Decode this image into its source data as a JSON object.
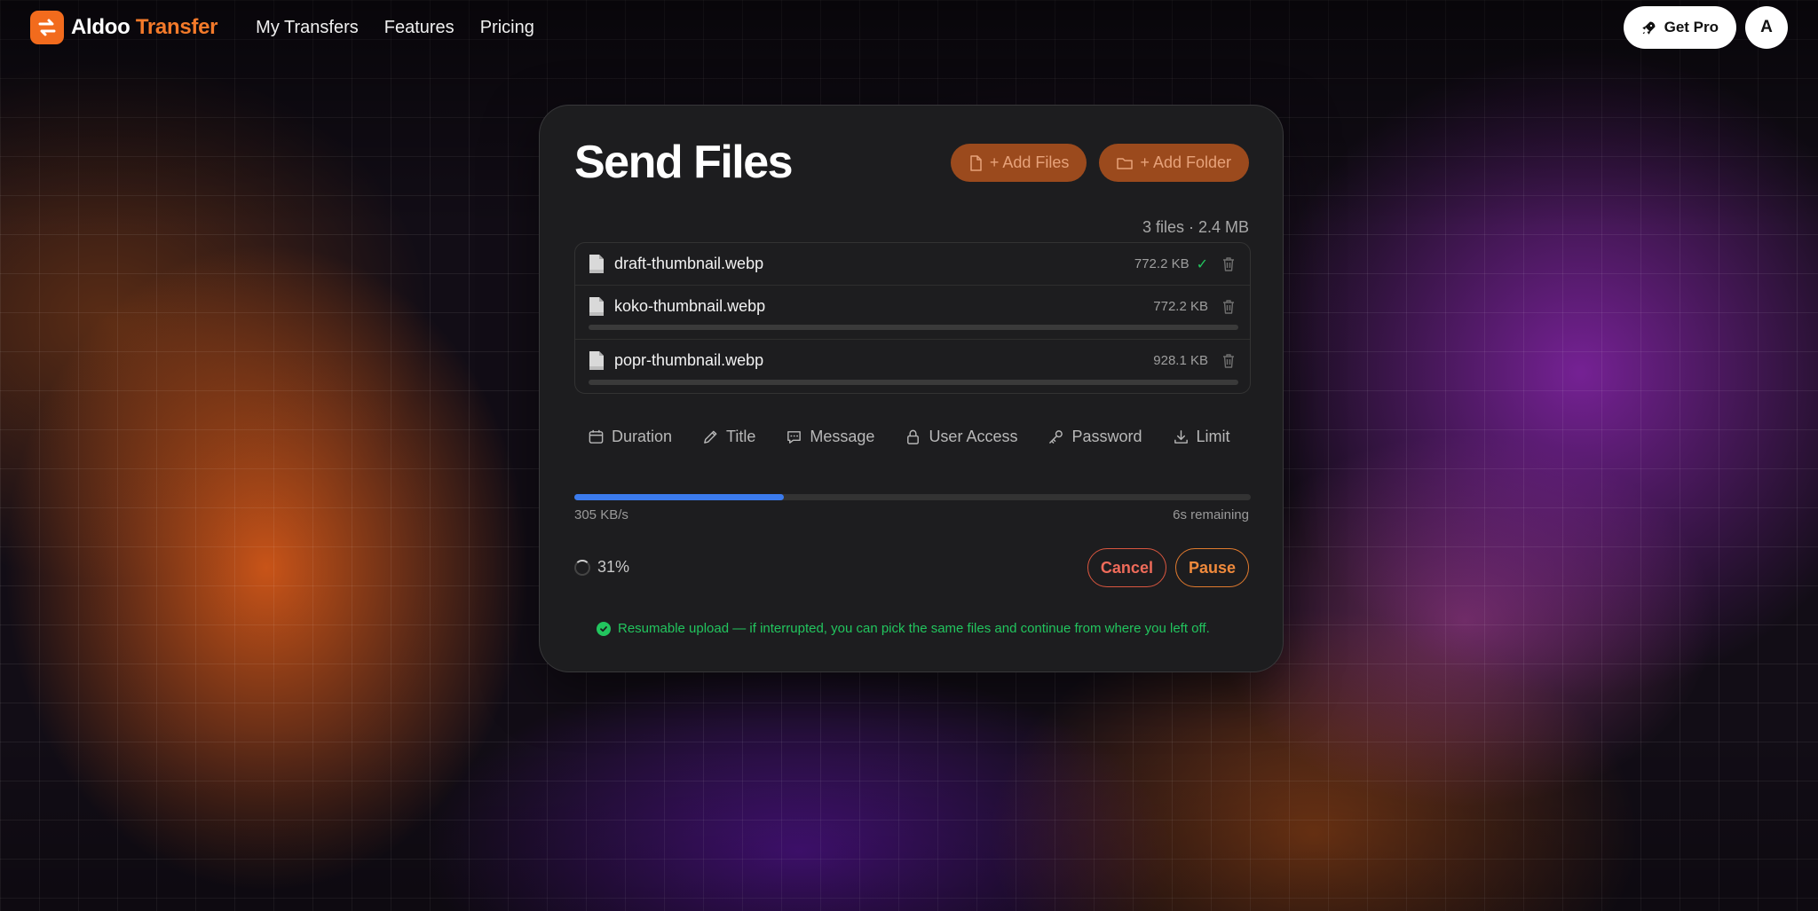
{
  "brand": {
    "name_part1": "Aldoo",
    "name_part2": "Transfer"
  },
  "nav": {
    "items": [
      "My Transfers",
      "Features",
      "Pricing"
    ]
  },
  "header": {
    "get_pro_label": "Get Pro",
    "avatar_initial": "A"
  },
  "card": {
    "title": "Send Files",
    "add_files_label": "+ Add Files",
    "add_folder_label": "+ Add Folder",
    "summary": "3 files · 2.4 MB",
    "files": [
      {
        "name": "draft-thumbnail.webp",
        "size": "772.2 KB",
        "done_mark": "✓"
      },
      {
        "name": "koko-thumbnail.webp",
        "size": "772.2 KB"
      },
      {
        "name": "popr-thumbnail.webp",
        "size": "928.1 KB"
      }
    ],
    "options": [
      "Duration",
      "Title",
      "Message",
      "User Access",
      "Password",
      "Limit"
    ],
    "progress": {
      "fraction": 0.31,
      "speed": "305 KB/s",
      "remaining": "6s remaining",
      "percent_label": "31%"
    },
    "cancel_label": "Cancel",
    "pause_label": "Pause",
    "notice": "Resumable upload — if interrupted, you can pick the same files and continue from where you left off."
  },
  "colors": {
    "accent_orange": "#f26b1d",
    "progress_blue": "#3b7bed",
    "success_green": "#22c55e",
    "card_bg": "#1d1d1f"
  },
  "icons": {
    "logo": "transfer-arrows-icon",
    "get_pro": "rocket-icon",
    "add_files": "file-icon",
    "add_folder": "folder-icon",
    "file_row": "document-icon",
    "delete": "trash-icon",
    "options": [
      "calendar-icon",
      "pencil-icon",
      "chat-bubble-icon",
      "lock-icon",
      "key-icon",
      "download-icon"
    ],
    "notice": "check-circle-icon"
  }
}
